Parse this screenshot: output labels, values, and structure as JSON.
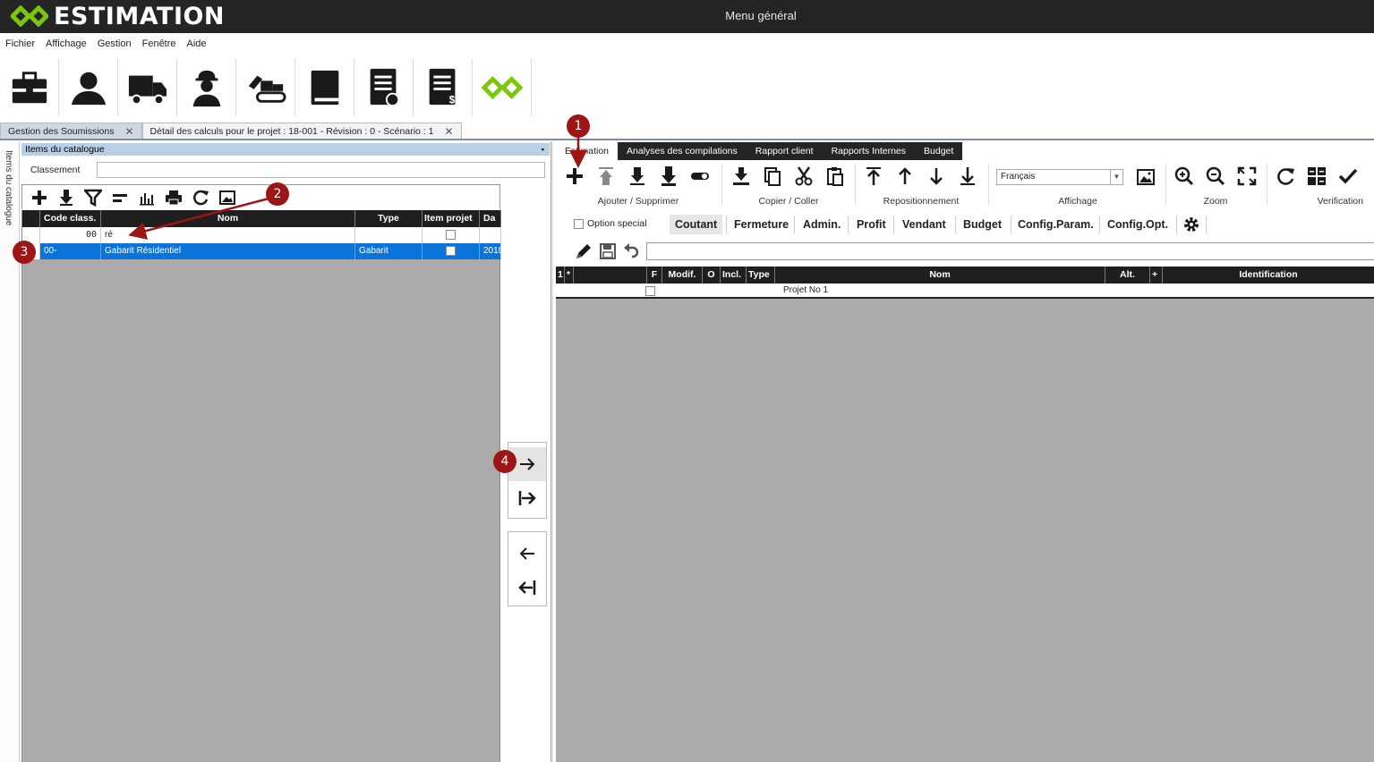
{
  "app": {
    "brand": "ESTIMATION",
    "window_title": "Menu général"
  },
  "colors": {
    "titlebar": "#252526",
    "brand_green": "#7ac70c",
    "selection": "#0a74da",
    "callout": "#9e1515",
    "grid_bg": "#ababab"
  },
  "menu": [
    "Fichier",
    "Affichage",
    "Gestion",
    "Fenêtre",
    "Aide"
  ],
  "main_toolbar": [
    "briefcase-icon",
    "contacts-icon",
    "truck-icon",
    "worker-icon",
    "excavator-icon",
    "book-icon",
    "document-check-icon",
    "document-dollar-icon",
    "logo-icon"
  ],
  "doc_tabs": [
    {
      "label": "Gestion des Soumissions",
      "close": "✕"
    },
    {
      "label": "Détail des calculs pour le projet : 18-001 - Révision : 0 - Scénario : 1",
      "close": "✕"
    }
  ],
  "left_strip_label": "Items du catalogue",
  "left_panel": {
    "title": "Items du catalogue",
    "pin": "📌",
    "classement_label": "Classement",
    "toolbar": [
      "add-icon",
      "download-icon",
      "filter-icon",
      "minus-icon",
      "chart-icon",
      "print-icon",
      "refresh-icon",
      "image-icon"
    ],
    "columns": [
      "Code class.",
      "Nom",
      "Type",
      "Item projet",
      "Da"
    ],
    "filter_row": {
      "code": "00",
      "nom": "ré"
    },
    "rows": [
      {
        "code": "00-",
        "nom": "Gabarit Résidentiel",
        "type": "Gabarit",
        "date": "2018"
      }
    ]
  },
  "transfer": [
    "arrow-right-icon",
    "arrow-right-bar-icon",
    "arrow-left-icon",
    "arrow-left-bar-icon"
  ],
  "right_panel": {
    "tabs": [
      "Estimation",
      "Analyses des compilations",
      "Rapport client",
      "Rapports Internes",
      "Budget"
    ],
    "groups": {
      "add_remove": "Ajouter / Supprimer",
      "copy_paste": "Copier / Coller",
      "reposition": "Repositionnement",
      "display": "Affichage",
      "zoom": "Zoom",
      "verification": "Verification"
    },
    "language": "Français",
    "option_special": "Option special",
    "filters": [
      "Coutant",
      "Fermeture",
      "Admin.",
      "Profit",
      "Vendant",
      "Budget",
      "Config.Param.",
      "Config.Opt."
    ],
    "columns": [
      "1",
      "*",
      "F",
      "Modif.",
      "O",
      "Incl.",
      "Type",
      "Nom",
      "Alt.",
      "+",
      "Identification"
    ],
    "rows": [
      {
        "nom": "Projet No 1"
      }
    ]
  },
  "callouts": [
    "1",
    "2",
    "3",
    "4"
  ]
}
